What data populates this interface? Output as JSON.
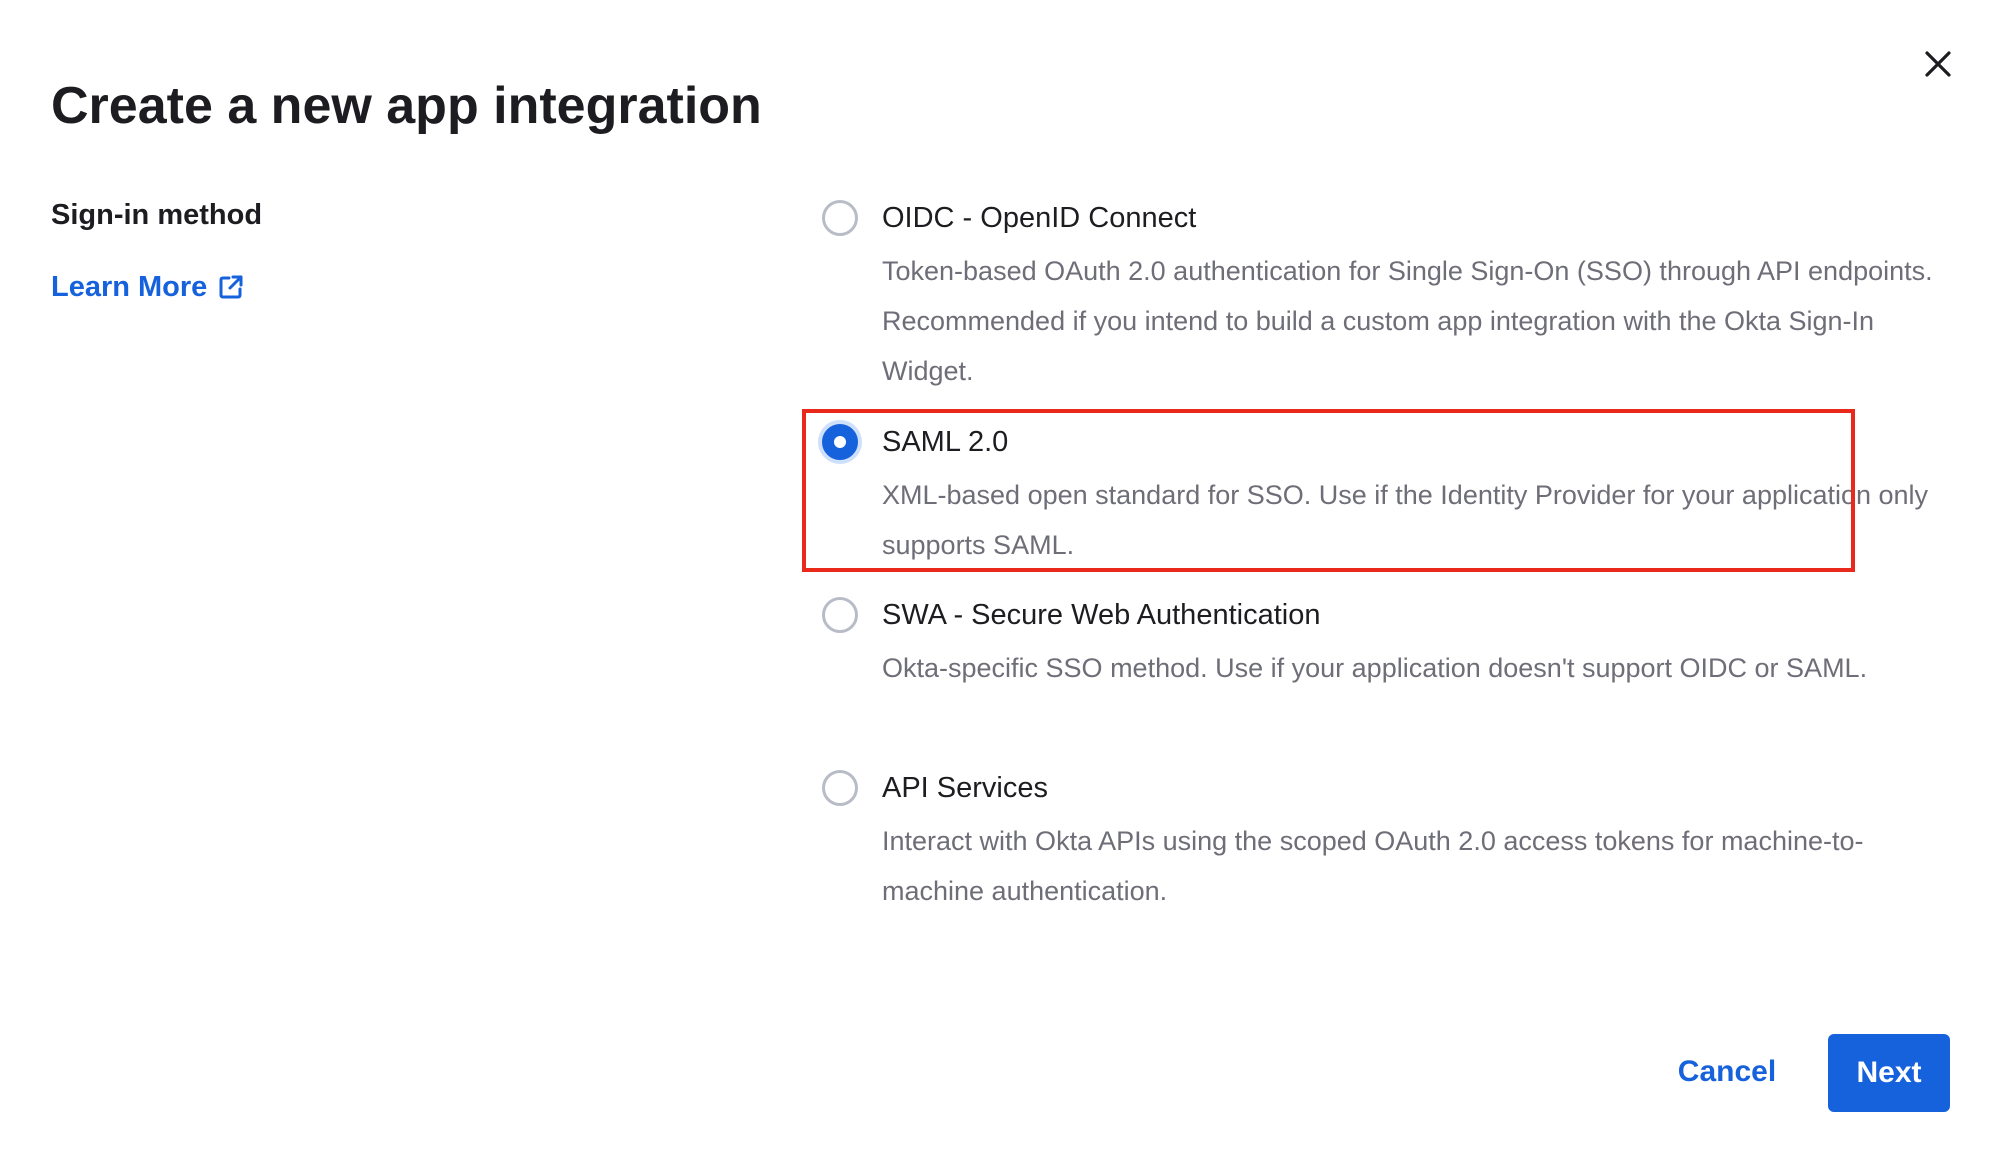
{
  "dialog": {
    "title": "Create a new app integration",
    "close_icon": "close-icon"
  },
  "sidebar": {
    "section_label": "Sign-in method",
    "learn_more_label": "Learn More",
    "learn_more_icon": "external-link-icon"
  },
  "options": [
    {
      "title": "OIDC - OpenID Connect",
      "description": "Token-based OAuth 2.0 authentication for Single Sign-On (SSO) through API endpoints. Recommended if you intend to build a custom app integration with the Okta Sign-In Widget.",
      "selected": false
    },
    {
      "title": "SAML 2.0",
      "description": "XML-based open standard for SSO. Use if the Identity Provider for your application only supports SAML.",
      "selected": true
    },
    {
      "title": "SWA - Secure Web Authentication",
      "description": "Okta-specific SSO method. Use if your application doesn't support OIDC or SAML.",
      "selected": false
    },
    {
      "title": "API Services",
      "description": "Interact with Okta APIs using the scoped OAuth 2.0 access tokens for machine-to-machine authentication.",
      "selected": false
    }
  ],
  "footer": {
    "cancel_label": "Cancel",
    "next_label": "Next"
  },
  "colors": {
    "accent": "#1662dd",
    "highlight": "#e8291c",
    "text": "#1d1d21",
    "muted": "#6e6e78"
  }
}
